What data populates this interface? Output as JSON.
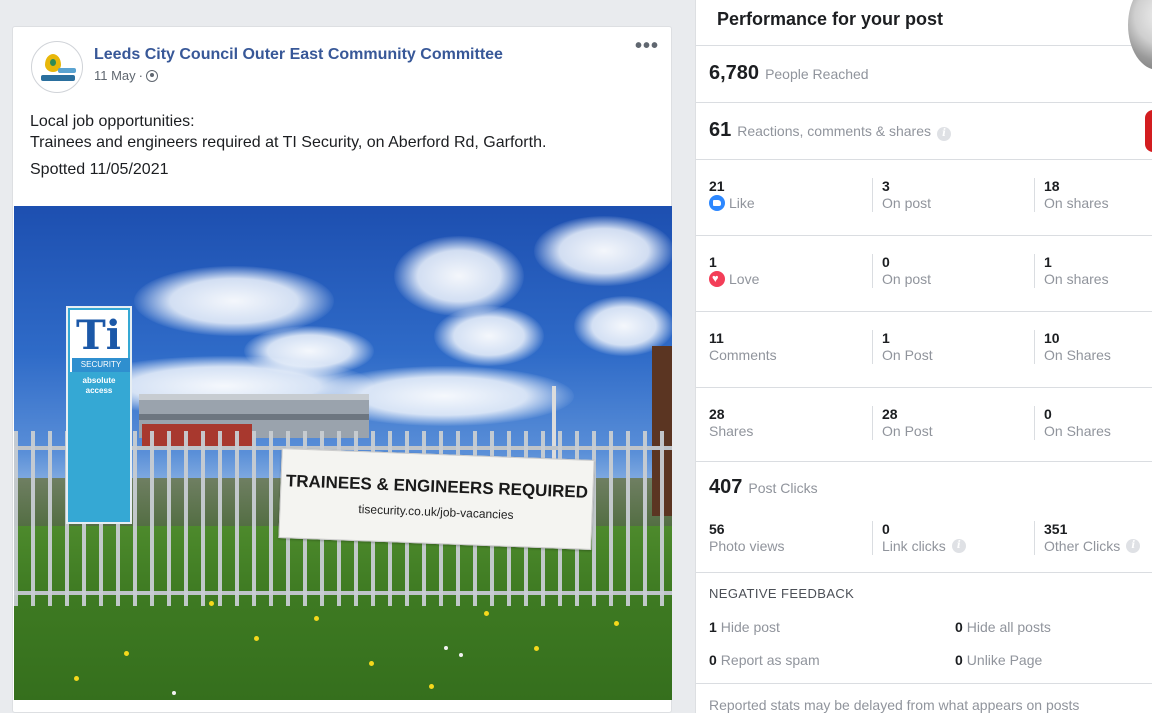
{
  "post": {
    "page_name": "Leeds City Council Outer East Community Committee",
    "date": "11 May",
    "separator": "·",
    "more_label": "•••",
    "body_line1": "Local job opportunities:",
    "body_line2": "Trainees and engineers required at TI Security, on Aberford Rd, Garforth.",
    "body_line3": "Spotted 11/05/2021",
    "photo": {
      "banner_title": "TRAINEES & ENGINEERS REQUIRED",
      "banner_url": "tisecurity.co.uk/job-vacancies",
      "sign_logo": "Ti",
      "sign_sub": "SECURITY",
      "sign_tagline": "absolute access"
    }
  },
  "insights": {
    "title": "Performance for your post",
    "people_reached": {
      "value": "6,780",
      "label": "People Reached"
    },
    "engagement": {
      "value": "61",
      "label": "Reactions, comments & shares"
    },
    "rows": [
      {
        "icon": "like-icon",
        "c1": {
          "num": "21",
          "label": "Like"
        },
        "c2": {
          "num": "3",
          "label": "On post"
        },
        "c3": {
          "num": "18",
          "label": "On shares"
        }
      },
      {
        "icon": "love-icon",
        "c1": {
          "num": "1",
          "label": "Love"
        },
        "c2": {
          "num": "0",
          "label": "On post"
        },
        "c3": {
          "num": "1",
          "label": "On shares"
        }
      },
      {
        "c1": {
          "num": "11",
          "label": "Comments"
        },
        "c2": {
          "num": "1",
          "label": "On Post"
        },
        "c3": {
          "num": "10",
          "label": "On Shares"
        }
      },
      {
        "c1": {
          "num": "28",
          "label": "Shares"
        },
        "c2": {
          "num": "28",
          "label": "On Post"
        },
        "c3": {
          "num": "0",
          "label": "On Shares"
        }
      }
    ],
    "post_clicks": {
      "value": "407",
      "label": "Post Clicks"
    },
    "clicks": {
      "photo": {
        "num": "56",
        "label": "Photo views"
      },
      "link": {
        "num": "0",
        "label": "Link clicks"
      },
      "other": {
        "num": "351",
        "label": "Other Clicks"
      }
    },
    "info_glyph": "i",
    "negative_feedback": {
      "title": "NEGATIVE FEEDBACK",
      "hide_post": {
        "num": "1",
        "label": "Hide post"
      },
      "hide_all": {
        "num": "0",
        "label": "Hide all posts"
      },
      "spam": {
        "num": "0",
        "label": "Report as spam"
      },
      "unlike": {
        "num": "0",
        "label": "Unlike Page"
      }
    },
    "footer": "Reported stats may be delayed from what appears on posts"
  },
  "colors": {
    "link_blue": "#385898",
    "like_blue": "#2d88ff",
    "love_red": "#f33e58",
    "muted": "#90949c"
  }
}
